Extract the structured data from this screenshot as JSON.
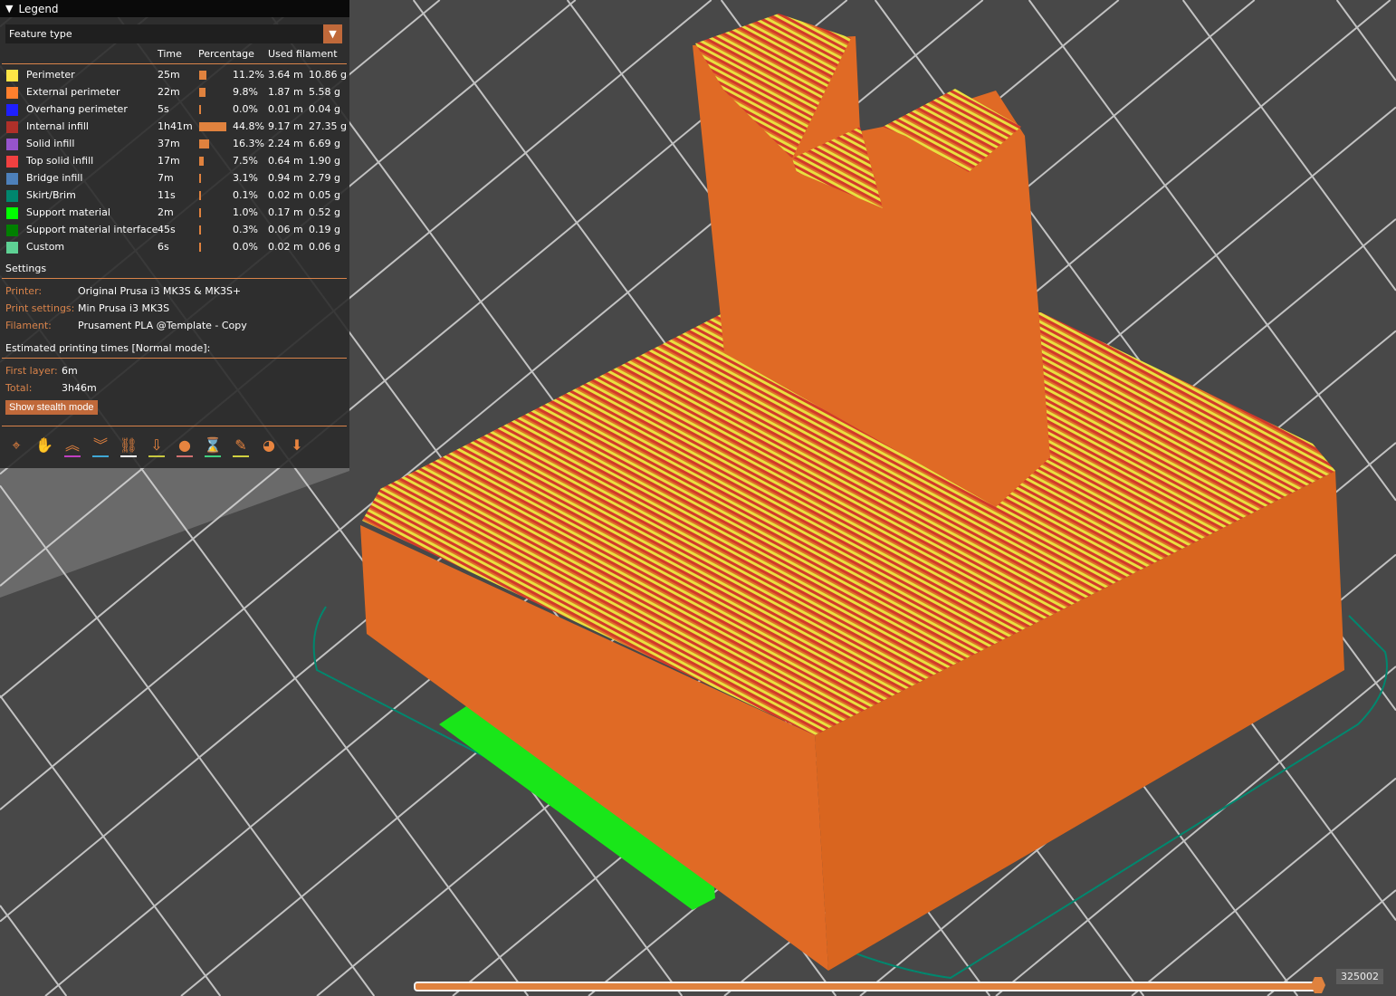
{
  "legend": {
    "title": "Legend",
    "view_type": "Feature type",
    "columns": {
      "time": "Time",
      "percentage": "Percentage",
      "used_filament": "Used filament"
    },
    "rows": [
      {
        "label": "Perimeter",
        "color": "#FFE546",
        "time": "25m",
        "pct": "11.2%",
        "pct_value": 11.2,
        "length": "3.64 m",
        "weight": "10.86 g"
      },
      {
        "label": "External perimeter",
        "color": "#FF7F2D",
        "time": "22m",
        "pct": "9.8%",
        "pct_value": 9.8,
        "length": "1.87 m",
        "weight": "5.58 g"
      },
      {
        "label": "Overhang perimeter",
        "color": "#1F1FFF",
        "time": "5s",
        "pct": "0.0%",
        "pct_value": 0.0,
        "length": "0.01 m",
        "weight": "0.04 g"
      },
      {
        "label": "Internal infill",
        "color": "#B03029",
        "time": "1h41m",
        "pct": "44.8%",
        "pct_value": 44.8,
        "length": "9.17 m",
        "weight": "27.35 g"
      },
      {
        "label": "Solid infill",
        "color": "#9654CC",
        "time": "37m",
        "pct": "16.3%",
        "pct_value": 16.3,
        "length": "2.24 m",
        "weight": "6.69 g"
      },
      {
        "label": "Top solid infill",
        "color": "#F04040",
        "time": "17m",
        "pct": "7.5%",
        "pct_value": 7.5,
        "length": "0.64 m",
        "weight": "1.90 g"
      },
      {
        "label": "Bridge infill",
        "color": "#4D80BA",
        "time": "7m",
        "pct": "3.1%",
        "pct_value": 3.1,
        "length": "0.94 m",
        "weight": "2.79 g"
      },
      {
        "label": "Skirt/Brim",
        "color": "#00876E",
        "time": "11s",
        "pct": "0.1%",
        "pct_value": 0.1,
        "length": "0.02 m",
        "weight": "0.05 g"
      },
      {
        "label": "Support material",
        "color": "#00FF00",
        "time": "2m",
        "pct": "1.0%",
        "pct_value": 1.0,
        "length": "0.17 m",
        "weight": "0.52 g"
      },
      {
        "label": "Support material interface",
        "color": "#008000",
        "time": "45s",
        "pct": "0.3%",
        "pct_value": 0.3,
        "length": "0.06 m",
        "weight": "0.19 g"
      },
      {
        "label": "Custom",
        "color": "#5ED194",
        "time": "6s",
        "pct": "0.0%",
        "pct_value": 0.0,
        "length": "0.02 m",
        "weight": "0.06 g"
      }
    ]
  },
  "settings": {
    "title": "Settings",
    "printer_label": "Printer:",
    "printer": "Original Prusa i3 MK3S & MK3S+",
    "print_label": "Print settings:",
    "print": "Min Prusa i3 MK3S",
    "filament_label": "Filament:",
    "filament": "Prusament PLA @Template - Copy"
  },
  "times": {
    "title": "Estimated printing times [Normal mode]:",
    "first_layer_label": "First layer:",
    "first_layer": "6m",
    "total_label": "Total:",
    "total": "3h46m",
    "stealth_button": "Show stealth mode"
  },
  "toolbar": [
    {
      "icon": "travel-icon",
      "glyph": "⌖",
      "underline": ""
    },
    {
      "icon": "wipe-icon",
      "glyph": "✋",
      "underline": ""
    },
    {
      "icon": "retractions-icon",
      "glyph": "︽",
      "underline": "#C040C0"
    },
    {
      "icon": "deretractions-icon",
      "glyph": "︾",
      "underline": "#3FA7D6"
    },
    {
      "icon": "seams-icon",
      "glyph": "⛓",
      "underline": "#ffffff"
    },
    {
      "icon": "tool-changes-icon",
      "glyph": "⇩",
      "underline": "#C8C840"
    },
    {
      "icon": "color-changes-icon",
      "glyph": "●",
      "underline": "#D07070"
    },
    {
      "icon": "pause-prints-icon",
      "glyph": "⌛",
      "underline": "#40D080"
    },
    {
      "icon": "custom-gcodes-icon",
      "glyph": "✎",
      "underline": "#D0D040"
    },
    {
      "icon": "center-of-gravity-icon",
      "glyph": "◕",
      "underline": ""
    },
    {
      "icon": "shells-icon",
      "glyph": "⬇",
      "underline": ""
    }
  ],
  "slider": {
    "value": "325002",
    "fraction": 1.0
  }
}
